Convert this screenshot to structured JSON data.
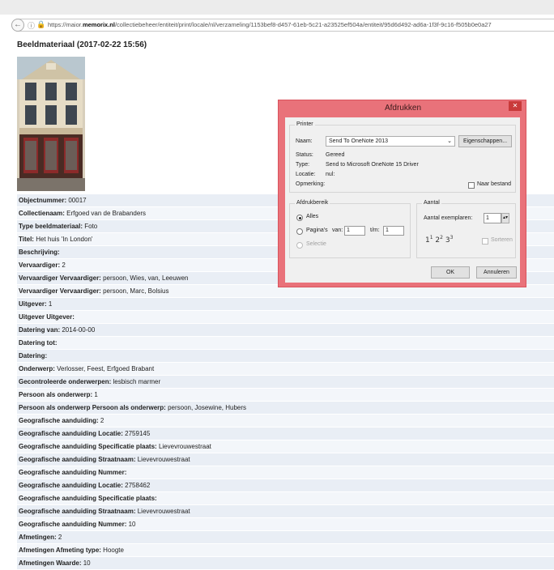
{
  "browser": {
    "url_prefix": "https://maior.",
    "url_domain": "memorix.nl",
    "url_suffix": "/collectiebeheer/entiteit/print/locale/nl/verzameling/1153bef8-d457-61eb-5c21-a23525ef504a/entiteit/95d6d492-ad6a-1f3f-9c16-f505b0e0a27"
  },
  "page": {
    "title": "Beeldmateriaal (2017-02-22 15:56)",
    "fields": [
      {
        "label": "Objectnummer:",
        "value": "00017"
      },
      {
        "label": "Collectienaam:",
        "value": "Erfgoed van de Brabanders"
      },
      {
        "label": "Type beeldmateriaal:",
        "value": "Foto"
      },
      {
        "label": "Titel:",
        "value": "Het huis 'In London'"
      },
      {
        "label": "Beschrijving:",
        "value": ""
      },
      {
        "label": "Vervaardiger:",
        "value": "2"
      },
      {
        "label": "Vervaardiger Vervaardiger:",
        "value": "persoon, Wies, van, Leeuwen"
      },
      {
        "label": "Vervaardiger Vervaardiger:",
        "value": "persoon, Marc, Bolsius"
      },
      {
        "label": "Uitgever:",
        "value": "1"
      },
      {
        "label": "Uitgever Uitgever:",
        "value": ""
      },
      {
        "label": "Datering van:",
        "value": "2014-00-00"
      },
      {
        "label": "Datering tot:",
        "value": ""
      },
      {
        "label": "Datering:",
        "value": ""
      },
      {
        "label": "Onderwerp:",
        "value": "Verlosser, Feest, Erfgoed Brabant"
      },
      {
        "label": "Gecontroleerde onderwerpen:",
        "value": "lesbisch marmer"
      },
      {
        "label": "Persoon als onderwerp:",
        "value": "1"
      },
      {
        "label": "Persoon als onderwerp Persoon als onderwerp:",
        "value": "persoon, Josewine, Hubers"
      },
      {
        "label": "Geografische aanduiding:",
        "value": "2"
      },
      {
        "label": "Geografische aanduiding Locatie:",
        "value": "2759145"
      },
      {
        "label": "Geografische aanduiding Specificatie plaats:",
        "value": "Lievevrouwestraat"
      },
      {
        "label": "Geografische aanduiding Straatnaam:",
        "value": "Lievevrouwestraat"
      },
      {
        "label": "Geografische aanduiding Nummer:",
        "value": ""
      },
      {
        "label": "Geografische aanduiding Locatie:",
        "value": "2758462"
      },
      {
        "label": "Geografische aanduiding Specificatie plaats:",
        "value": ""
      },
      {
        "label": "Geografische aanduiding Straatnaam:",
        "value": "Lievevrouwestraat"
      },
      {
        "label": "Geografische aanduiding Nummer:",
        "value": "10"
      },
      {
        "label": "Afmetingen:",
        "value": "2"
      },
      {
        "label": "Afmetingen Afmeting type:",
        "value": "Hoogte"
      },
      {
        "label": "Afmetingen Waarde:",
        "value": "10"
      }
    ]
  },
  "dialog": {
    "title": "Afdrukken",
    "close_glyph": "✕",
    "printer": {
      "group_label": "Printer",
      "name_label": "Naam:",
      "name_value": "Send To OneNote 2013",
      "properties_button": "Eigenschappen...",
      "status_label": "Status:",
      "status_value": "Gereed",
      "type_label": "Type:",
      "type_value": "Send to Microsoft OneNote 15 Driver",
      "location_label": "Locatie:",
      "location_value": "nul:",
      "comment_label": "Opmerking:",
      "comment_value": "",
      "print_to_file_label": "Naar bestand"
    },
    "range": {
      "group_label": "Afdrukbereik",
      "all_label": "Alles",
      "pages_label": "Pagina's",
      "from_label": "van:",
      "from_value": "1",
      "to_label": "t/m:",
      "to_value": "1",
      "selection_label": "Selectie"
    },
    "copies": {
      "group_label": "Aantal",
      "count_label": "Aantal exemplaren:",
      "count_value": "1",
      "collate_label": "Sorteren"
    },
    "ok_button": "OK",
    "cancel_button": "Annuleren"
  },
  "icons": {
    "back": "back-arrow-icon",
    "info": "info-icon",
    "lock": "lock-icon",
    "dropdown": "chevron-down-icon",
    "spinner": "spinner-icon",
    "collate": "collate-pages-icon"
  },
  "colors": {
    "dialog_frame": "#e9727a",
    "close_button": "#c93a3a",
    "row_odd": "#e9eef5",
    "row_even": "#f3f6fa"
  }
}
